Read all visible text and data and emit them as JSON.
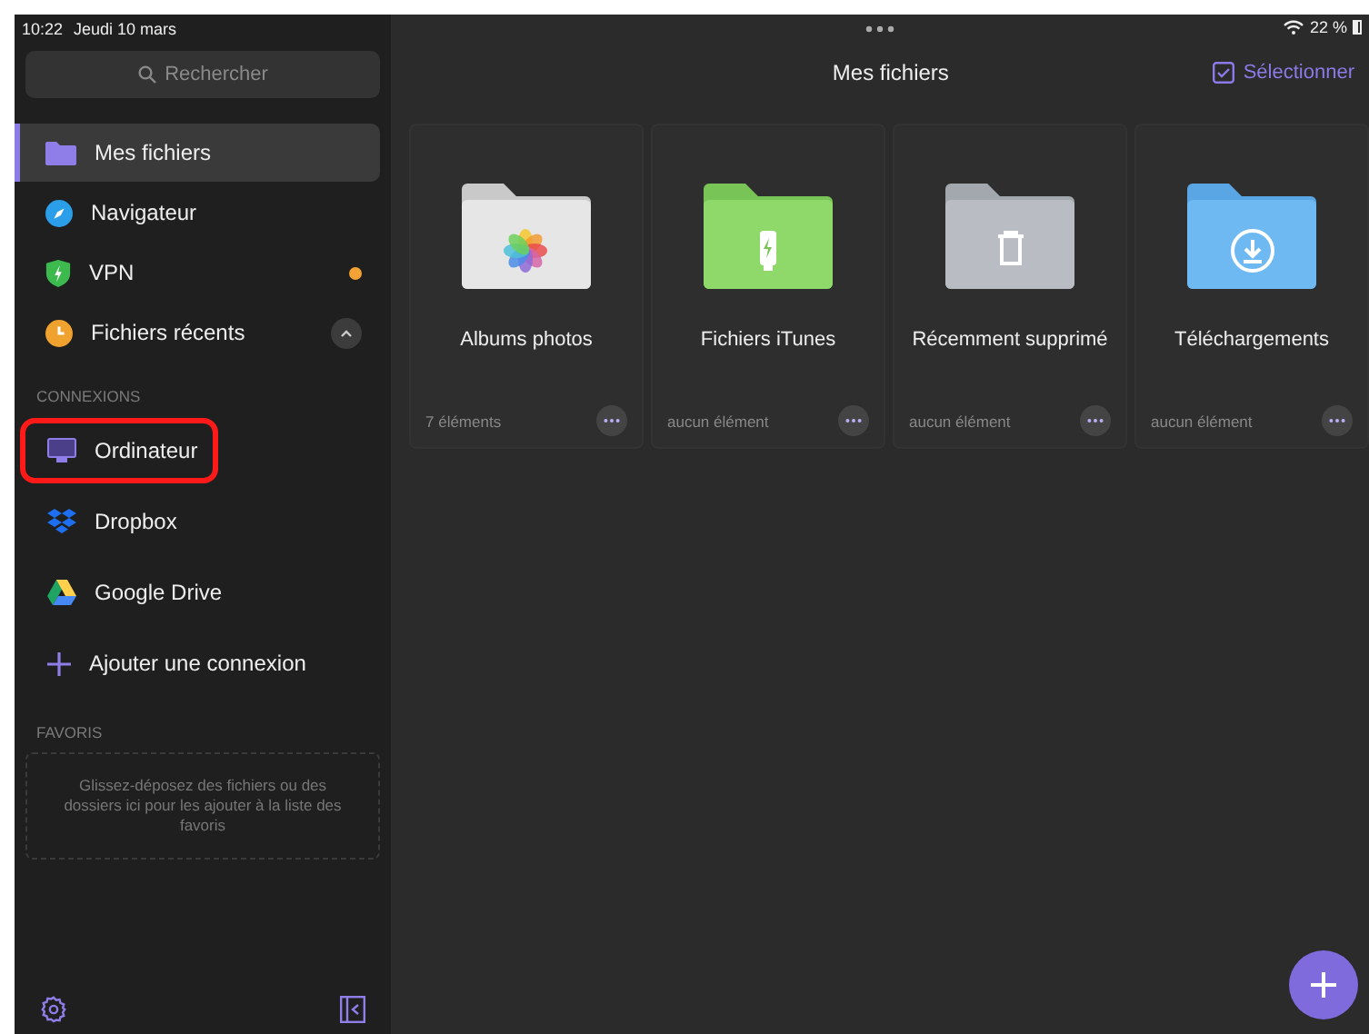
{
  "status_bar": {
    "time": "10:22",
    "date": "Jeudi 10 mars",
    "battery": "22 %"
  },
  "sidebar": {
    "search": {
      "placeholder": "Rechercher"
    },
    "items": [
      {
        "kind": "folder",
        "label": "Mes fichiers",
        "selected": true,
        "status_dot": false,
        "collapsible": false
      },
      {
        "kind": "compass",
        "label": "Navigateur",
        "selected": false,
        "status_dot": false,
        "collapsible": false
      },
      {
        "kind": "shield",
        "label": "VPN",
        "selected": false,
        "status_dot": true,
        "collapsible": false
      },
      {
        "kind": "clock",
        "label": "Fichiers récents",
        "selected": false,
        "status_dot": false,
        "collapsible": true
      }
    ],
    "connections_title": "CONNEXIONS",
    "connections": [
      {
        "kind": "computer",
        "label": "Ordinateur",
        "highlighted": true
      },
      {
        "kind": "dropbox",
        "label": "Dropbox",
        "highlighted": false
      },
      {
        "kind": "drive",
        "label": "Google Drive",
        "highlighted": false
      },
      {
        "kind": "add",
        "label": "Ajouter une connexion",
        "highlighted": false
      }
    ],
    "favorites_title": "FAVORIS",
    "favorites_hint": "Glissez-déposez des fichiers ou des dossiers ici pour les ajouter à la liste des favoris"
  },
  "main": {
    "title": "Mes fichiers",
    "select_button": "Sélectionner",
    "folders": [
      {
        "kind": "photos",
        "name": "Albums photos",
        "count": "7 éléments"
      },
      {
        "kind": "itunes",
        "name": "Fichiers iTunes",
        "count": "aucun élément"
      },
      {
        "kind": "trash",
        "name": "Récemment supprimé",
        "count": "aucun élément"
      },
      {
        "kind": "downloads",
        "name": "Téléchargements",
        "count": "aucun élément"
      }
    ]
  }
}
